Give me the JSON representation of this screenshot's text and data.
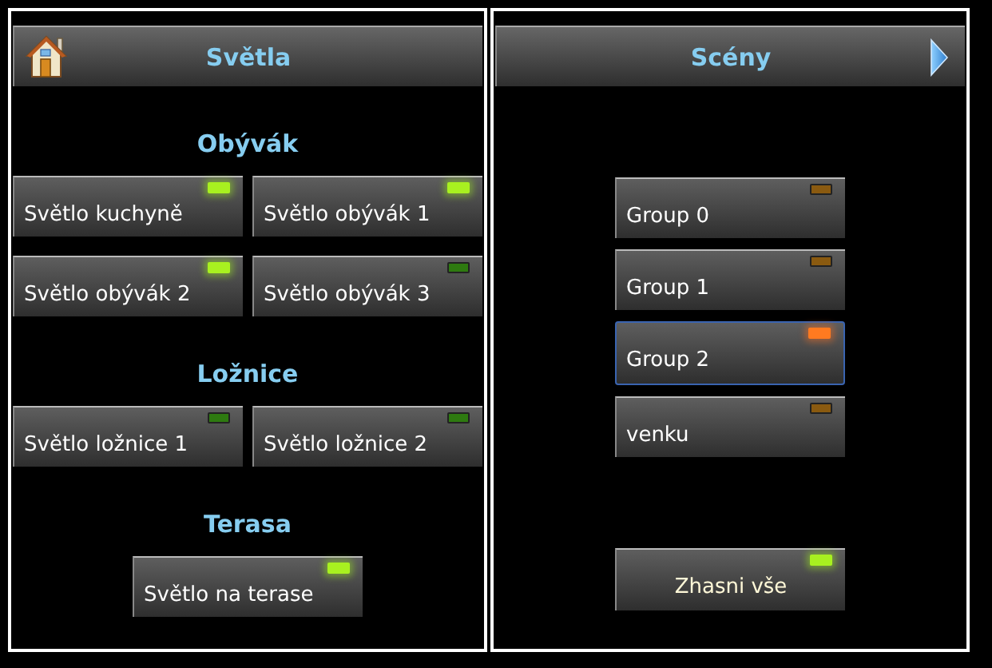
{
  "lights": {
    "title": "Světla",
    "rooms": [
      {
        "name": "Obývák",
        "switches": [
          {
            "label": "Světlo kuchyně",
            "on": true
          },
          {
            "label": "Světlo obývák 1",
            "on": true
          },
          {
            "label": "Světlo obývák 2",
            "on": true
          },
          {
            "label": "Světlo obývák 3",
            "on": false
          }
        ]
      },
      {
        "name": "Ložnice",
        "switches": [
          {
            "label": "Světlo ložnice 1",
            "on": false
          },
          {
            "label": "Světlo ložnice 2",
            "on": false
          }
        ]
      },
      {
        "name": "Terasa",
        "switches": [
          {
            "label": "Světlo na terase",
            "on": true
          }
        ]
      }
    ]
  },
  "scenes": {
    "title": "Scény",
    "groups": [
      {
        "label": "Group 0",
        "on": false,
        "selected": false
      },
      {
        "label": "Group 1",
        "on": false,
        "selected": false
      },
      {
        "label": "Group 2",
        "on": true,
        "selected": true
      },
      {
        "label": "venku",
        "on": false,
        "selected": false
      }
    ],
    "all_off": {
      "label": "Zhasni vše",
      "on": true
    }
  }
}
